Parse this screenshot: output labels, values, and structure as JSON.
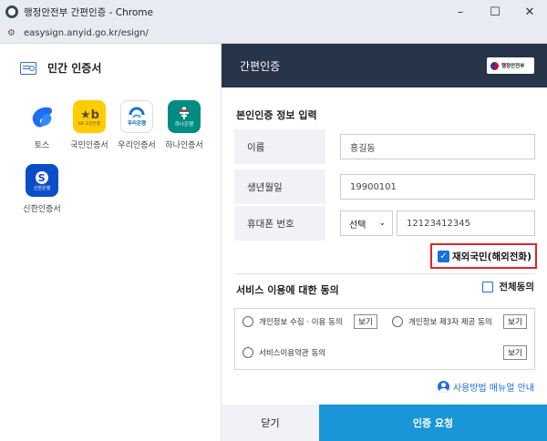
{
  "window": {
    "title": "행정안전부 간편인증 - Chrome",
    "minimize": "–",
    "maximize": "☐",
    "close": "✕",
    "url": "easysign.anyid.go.kr/esign/"
  },
  "left_panel": {
    "header": "민간 인증서",
    "providers": [
      {
        "name": "토스",
        "logo": "toss-logo"
      },
      {
        "name": "국민인증서",
        "logo": "kb-logo",
        "logo_text": "KB 국민은행"
      },
      {
        "name": "우리인증서",
        "logo": "woori-logo",
        "logo_text": "우리은행"
      },
      {
        "name": "하나인증서",
        "logo": "hana-logo",
        "logo_text": "하나은행"
      },
      {
        "name": "신한인증서",
        "logo": "shinhan-logo",
        "logo_text": "신한은행"
      }
    ]
  },
  "right_panel": {
    "title": "간편인증",
    "gov_badge": "행정안전부",
    "section_identity": "본인인증 정보 입력",
    "fields": {
      "name": {
        "label": "이름",
        "placeholder": "홍길동"
      },
      "birth": {
        "label": "생년월일",
        "value": "19900101"
      },
      "phone": {
        "label": "휴대폰 번호",
        "carrier": "선택",
        "number": "12123412345"
      }
    },
    "overseas": {
      "label": "재외국민(해외전화)",
      "checked": true
    },
    "section_consent": "서비스 이용에 대한 동의",
    "all_agree": {
      "label": "전체동의",
      "checked": false
    },
    "consents": [
      {
        "label": "개인정보 수집 · 이용 동의",
        "view": "보기"
      },
      {
        "label": "개인정보 제3자 제공 동의",
        "view": "보기"
      },
      {
        "label": "서비스이용약관 동의",
        "view": "보기"
      }
    ],
    "manual_link": "사용방법 매뉴얼 안내",
    "close_button": "닫기",
    "auth_button": "인증 요청"
  },
  "colors": {
    "header_bg": "#27344a",
    "accent": "#1b6ee0",
    "auth_button": "#1a96d8",
    "highlight_border": "#e0242a"
  }
}
